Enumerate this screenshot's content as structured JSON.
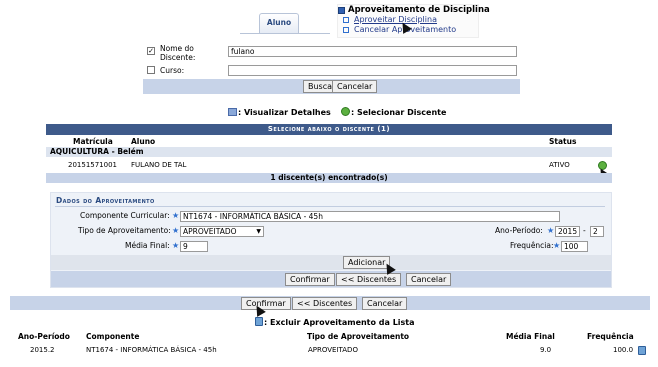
{
  "tab": {
    "label": "Aluno"
  },
  "menu": {
    "title": "Aproveitamento de Disciplina",
    "item1": "Aproveitar Disciplina",
    "item2": "Cancelar Aproveitamento"
  },
  "search": {
    "name_label": "Nome do Discente:",
    "name_value": "fulano",
    "course_label": "Curso:",
    "course_value": "",
    "buscar": "Buscar",
    "cancelar": "Cancelar"
  },
  "legend": {
    "view_details": ": Visualizar Detalhes",
    "select_student": ": Selecionar Discente"
  },
  "students": {
    "caption": "Selecione abaixo o discente (1)",
    "headers": {
      "matricula": "Matrícula",
      "aluno": "Aluno",
      "status": "Status"
    },
    "group": "AQUICULTURA - Belém",
    "rows": [
      {
        "matricula": "20151571001",
        "nome": "FULANO DE TAL",
        "status": "ATIVO"
      }
    ],
    "footer": "1 discente(s) encontrado(s)"
  },
  "form": {
    "title": "Dados do Aproveitamento",
    "componente_label": "Componente Curricular:",
    "componente_value": "NT1674 - INFORMÁTICA BÁSICA - 45h",
    "tipo_label": "Tipo de Aproveitamento:",
    "tipo_value": "APROVEITADO",
    "ano_label": "Ano-Período:",
    "ano_value": "2015",
    "periodo_sep": "-",
    "periodo_value": "2",
    "media_label": "Média Final:",
    "media_value": "9",
    "freq_label": "Frequência:",
    "freq_value": "100",
    "adicionar": "Adicionar",
    "confirmar": "Confirmar",
    "discentes": "<< Discentes",
    "cancelar": "Cancelar"
  },
  "bottom": {
    "confirmar": "Confirmar",
    "discentes": "<< Discentes",
    "cancelar": "Cancelar",
    "delete_legend": ": Excluir Aproveitamento da Lista",
    "headers": {
      "ano": "Ano-Período",
      "componente": "Componente",
      "tipo": "Tipo de Aproveitamento",
      "media": "Média Final",
      "freq": "Frequência"
    },
    "rows": [
      {
        "ano": "2015.2",
        "componente": "NT1674 - INFORMÁTICA BÁSICA - 45h",
        "tipo": "APROVEITADO",
        "media": "9.0",
        "freq": "100.0"
      }
    ]
  },
  "colors": {
    "header_dark": "#3e5a8a",
    "header_light": "#c7d3e8",
    "group_bg": "#dde4ef",
    "form_bg": "#eef2f8",
    "accent_title": "#2a4a80"
  }
}
